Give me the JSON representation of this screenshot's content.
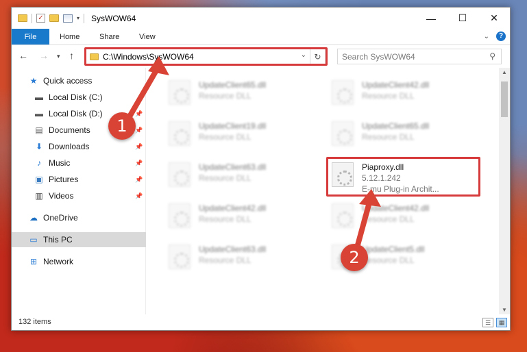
{
  "window": {
    "title": "SysWOW64",
    "minimize": "—",
    "maximize": "☐",
    "close": "✕"
  },
  "ribbon": {
    "file": "File",
    "home": "Home",
    "share": "Share",
    "view": "View"
  },
  "address": {
    "path": "C:\\Windows\\SysWOW64",
    "search_placeholder": "Search SysWOW64"
  },
  "navpane": [
    {
      "label": "Quick access",
      "icon": "star-icon"
    },
    {
      "label": "Local Disk (C:)",
      "icon": "drive-icon"
    },
    {
      "label": "Local Disk (D:)",
      "icon": "drive-icon"
    },
    {
      "label": "Documents",
      "icon": "documents-icon"
    },
    {
      "label": "Downloads",
      "icon": "downloads-icon"
    },
    {
      "label": "Music",
      "icon": "music-icon"
    },
    {
      "label": "Pictures",
      "icon": "pictures-icon"
    },
    {
      "label": "Videos",
      "icon": "videos-icon"
    },
    {
      "label": "OneDrive",
      "icon": "cloud-icon"
    },
    {
      "label": "This PC",
      "icon": "computer-icon"
    },
    {
      "label": "Network",
      "icon": "network-icon"
    }
  ],
  "files": [
    {
      "name": "UpdateClient65.dll",
      "desc": "Resource DLL"
    },
    {
      "name": "UpdateClient42.dll",
      "desc": "Resource DLL"
    },
    {
      "name": "UpdateClient19.dll",
      "desc": "Resource DLL"
    },
    {
      "name": "UpdateClient65.dll",
      "desc": "Resource DLL"
    },
    {
      "name": "UpdateClient63.dll",
      "desc": "Resource DLL"
    },
    {
      "name": "UpdateClient42.dll",
      "desc": "Resource DLL"
    },
    {
      "name": "UpdateClient63.dll",
      "desc": "Resource DLL"
    },
    {
      "name": "UpdateClient5.dll",
      "desc": "Resource DLL"
    }
  ],
  "highlighted_file": {
    "name": "Piaproxy.dll",
    "version": "5.12.1.242",
    "desc": "E-mu Plug-in Archit..."
  },
  "status": {
    "count": "132 items"
  },
  "annotations": {
    "step1": "1",
    "step2": "2",
    "color": "#d94336"
  }
}
